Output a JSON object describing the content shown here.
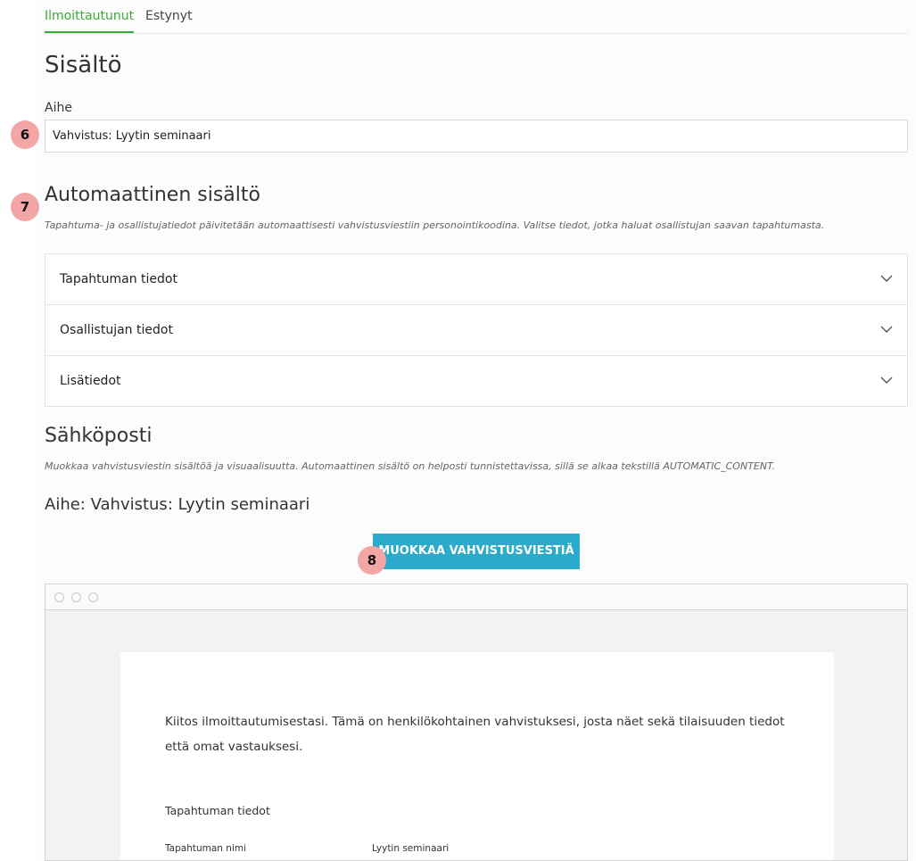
{
  "tabs": [
    {
      "label": "Ilmoittautunut",
      "active": true
    },
    {
      "label": "Estynyt",
      "active": false
    }
  ],
  "content": {
    "title": "Sisältö",
    "subject_label": "Aihe",
    "subject_value": "Vahvistus: Lyytin seminaari"
  },
  "markers": [
    "6",
    "7",
    "8"
  ],
  "automatic": {
    "title": "Automaattinen sisältö",
    "description": "Tapahtuma- ja osallistujatiedot päivitetään automaattisesti vahvistusviestiin personointikoodina. Valitse tiedot, jotka haluat osallistujan saavan tapahtumasta.",
    "sections": [
      {
        "label": "Tapahtuman tiedot",
        "icon": "chevron-down-icon"
      },
      {
        "label": "Osallistujan tiedot",
        "icon": "chevron-down-icon"
      },
      {
        "label": "Lisätiedot",
        "icon": "chevron-down-icon"
      }
    ]
  },
  "email": {
    "title": "Sähköposti",
    "description": "Muokkaa vahvistusviestin sisältöä ja visuaalisuutta. Automaattinen sisältö on helposti tunnistettavissa, sillä se alkaa tekstillä AUTOMATIC_CONTENT.",
    "subject_line": "Aihe: Vahvistus: Lyytin seminaari",
    "edit_button": "MUOKKAA VAHVISTUSVIESTIÄ"
  },
  "preview": {
    "intro": "Kiitos ilmoittautumisestasi. Tämä on henkilökohtainen vahvistuksesi, josta näet sekä tilaisuuden tiedot että omat vastauksesi.",
    "section_title": "Tapahtuman tiedot",
    "rows": [
      {
        "key": "Tapahtuman nimi",
        "value": "Lyytin seminaari"
      }
    ]
  },
  "colors": {
    "accent_green": "#3aaa35",
    "button_blue": "#2baacb",
    "marker_pink": "#f4a6a6"
  }
}
